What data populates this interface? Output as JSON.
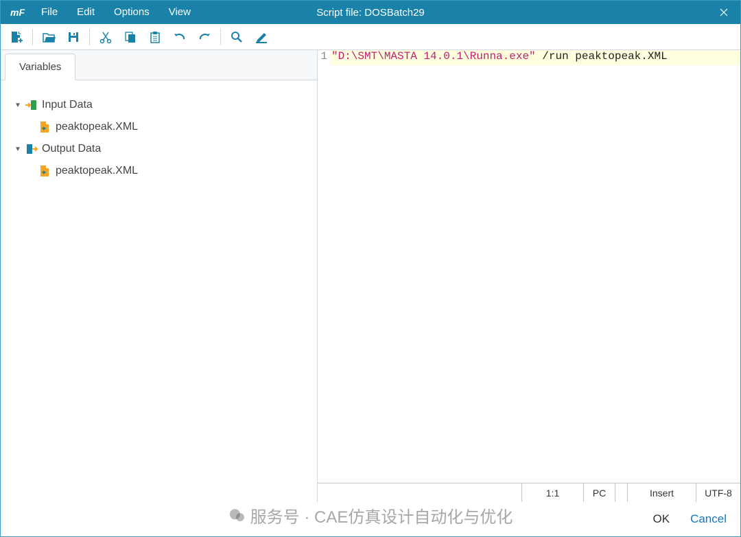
{
  "titlebar": {
    "app_logo": "mF",
    "menu": [
      "File",
      "Edit",
      "Options",
      "View"
    ],
    "title": "Script file: DOSBatch29"
  },
  "toolbar": {
    "icons": [
      "new-file",
      "open-folder",
      "save",
      "cut",
      "copy",
      "paste",
      "undo",
      "redo",
      "search",
      "highlight"
    ]
  },
  "left": {
    "tab": "Variables",
    "tree": [
      {
        "label": "Input Data",
        "icon": "input-data",
        "expanded": true,
        "depth": 0
      },
      {
        "label": "peaktopeak.XML",
        "icon": "file-xml",
        "depth": 1
      },
      {
        "label": "Output Data",
        "icon": "output-data",
        "expanded": true,
        "depth": 0
      },
      {
        "label": "peaktopeak.XML",
        "icon": "file-xml",
        "depth": 1
      }
    ]
  },
  "editor": {
    "lines": [
      {
        "num": "1",
        "str": "\"D:\\SMT\\MASTA 14.0.1\\Runna.exe\"",
        "rest": " /run peaktopeak.XML"
      }
    ]
  },
  "status": {
    "pos": "1:1",
    "pc": "PC",
    "mode": "Insert",
    "enc": "UTF-8"
  },
  "buttons": {
    "ok": "OK",
    "cancel": "Cancel"
  },
  "watermark": "服务号 · CAE仿真设计自动化与优化"
}
